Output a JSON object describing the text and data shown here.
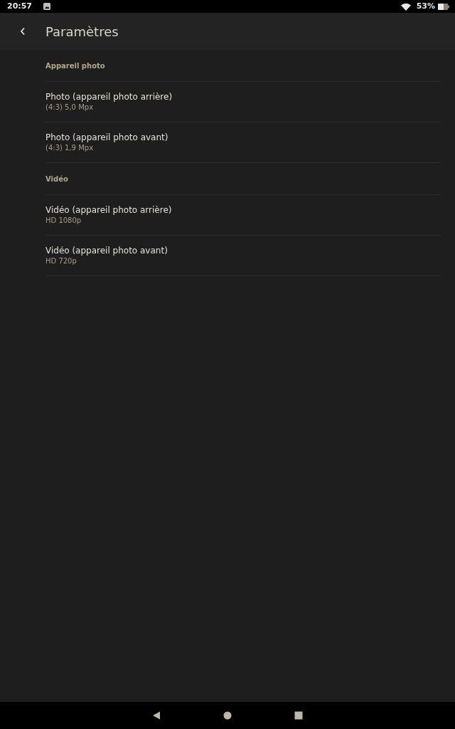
{
  "status_bar": {
    "time": "20:57",
    "battery": "53%"
  },
  "header": {
    "title": "Paramètres"
  },
  "sections": [
    {
      "kind": "header",
      "label": "Appareil photo"
    },
    {
      "kind": "item",
      "title": "Photo (appareil photo arrière)",
      "subtitle": "(4:3) 5,0 Mpx"
    },
    {
      "kind": "item",
      "title": "Photo (appareil photo avant)",
      "subtitle": "(4:3) 1,9 Mpx"
    },
    {
      "kind": "header",
      "label": "Vidéo"
    },
    {
      "kind": "item",
      "title": "Vidéo (appareil photo arrière)",
      "subtitle": "HD 1080p"
    },
    {
      "kind": "item",
      "title": "Vidéo (appareil photo avant)",
      "subtitle": "HD 720p"
    }
  ]
}
